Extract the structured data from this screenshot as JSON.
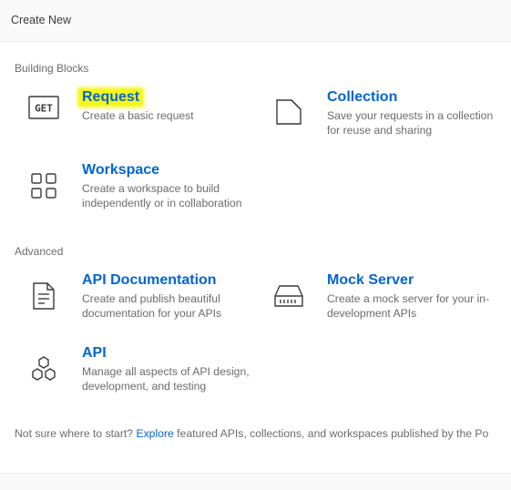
{
  "header": {
    "title": "Create New"
  },
  "sections": {
    "building_blocks": {
      "title": "Building Blocks",
      "items": [
        {
          "title": "Request",
          "description": "Create a basic request",
          "icon": "get-request-icon"
        },
        {
          "title": "Collection",
          "description": "Save your requests in a collection for reuse and sharing",
          "icon": "collection-icon"
        },
        {
          "title": "Workspace",
          "description": "Create a workspace to build independently or in collaboration",
          "icon": "workspace-grid-icon"
        }
      ]
    },
    "advanced": {
      "title": "Advanced",
      "items": [
        {
          "title": "API Documentation",
          "description": "Create and publish beautiful documentation for your APIs",
          "icon": "document-icon"
        },
        {
          "title": "Mock Server",
          "description": "Create a mock server for your in-development APIs",
          "icon": "server-icon"
        },
        {
          "title": "API",
          "description": "Manage all aspects of API design, development, and testing",
          "icon": "hexagons-icon"
        }
      ]
    }
  },
  "icons": {
    "get_label": "GET"
  },
  "footer": {
    "prefix": "Not sure where to start? ",
    "link": "Explore",
    "suffix": " featured APIs, collections, and workspaces published by the Po"
  },
  "colors": {
    "link": "#0265d2",
    "highlight": "#f4f71b",
    "muted_text": "#6b6b6b"
  }
}
